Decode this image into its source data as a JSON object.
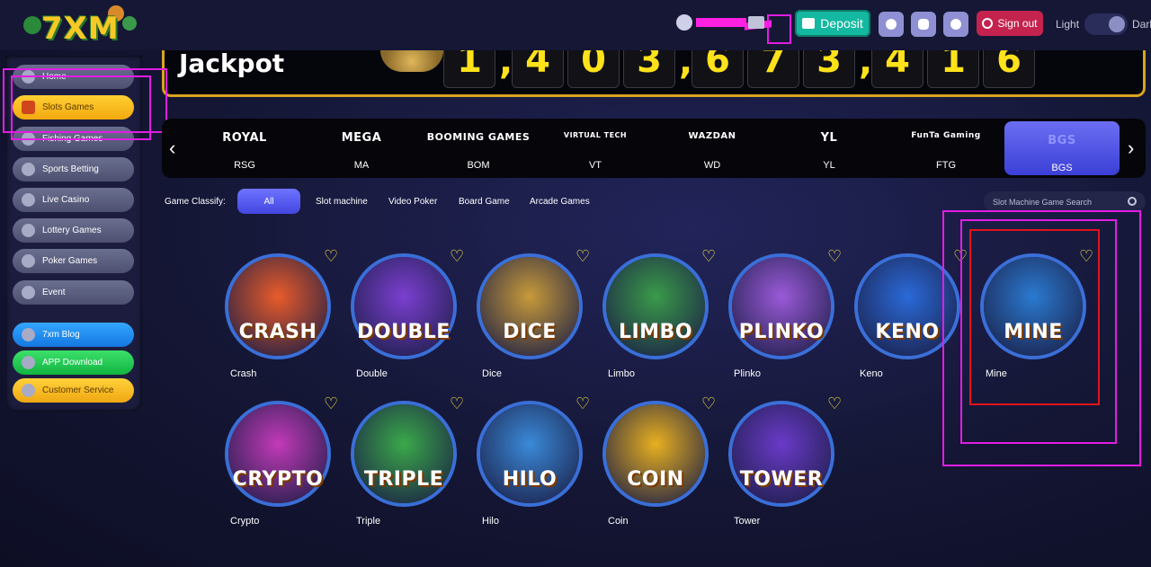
{
  "header": {
    "logo_text": "7XM",
    "deposit_label": "Deposit",
    "signout_label": "Sign out",
    "theme_light_label": "Light",
    "theme_dark_label": "Dark"
  },
  "jackpot": {
    "label": "Jackpot",
    "digits": [
      "1",
      "4",
      "0",
      "3",
      "6",
      "7",
      "3",
      "4",
      "1",
      "6"
    ]
  },
  "sidebar": {
    "items": [
      {
        "label": "Home",
        "icon": "home-icon"
      },
      {
        "label": "Slots Games",
        "icon": "slots-icon"
      },
      {
        "label": "Fishing Games",
        "icon": "fish-icon"
      },
      {
        "label": "Sports Betting",
        "icon": "soccer-ball-icon"
      },
      {
        "label": "Live Casino",
        "icon": "casino-chip-icon"
      },
      {
        "label": "Lottery Games",
        "icon": "lottery-icon"
      },
      {
        "label": "Poker Games",
        "icon": "poker-icon"
      },
      {
        "label": "Event",
        "icon": "event-icon"
      }
    ],
    "links": [
      {
        "label": "7xm Blog",
        "icon": "blog-icon"
      },
      {
        "label": "APP Download",
        "icon": "download-icon"
      },
      {
        "label": "Customer Service",
        "icon": "support-icon"
      }
    ]
  },
  "providers": [
    {
      "name": "RSG",
      "logo": "ROYAL"
    },
    {
      "name": "MA",
      "logo": "MEGA"
    },
    {
      "name": "BOM",
      "logo": "BOOMING GAMES"
    },
    {
      "name": "VT",
      "logo": "VIRTUAL TECH"
    },
    {
      "name": "WD",
      "logo": "WAZDAN"
    },
    {
      "name": "YL",
      "logo": "YL"
    },
    {
      "name": "FTG",
      "logo": "FunTa Gaming"
    },
    {
      "name": "BGS",
      "logo": "BGS"
    }
  ],
  "classify": {
    "label": "Game Classify:",
    "tabs": [
      "All",
      "Slot machine",
      "Video Poker",
      "Board Game",
      "Arcade Games"
    ],
    "search_placeholder": "Slot Machine Game Search"
  },
  "games": [
    {
      "name": "Crash",
      "word": "CRASH",
      "color": "#e85b2a"
    },
    {
      "name": "Double",
      "word": "DOUBLE",
      "color": "#7b3fd0"
    },
    {
      "name": "Dice",
      "word": "DICE",
      "color": "#c79a3a"
    },
    {
      "name": "Limbo",
      "word": "LIMBO",
      "color": "#3a9a4a"
    },
    {
      "name": "Plinko",
      "word": "PLINKO",
      "color": "#9a5ad8"
    },
    {
      "name": "Keno",
      "word": "KENO",
      "color": "#2a6ad8"
    },
    {
      "name": "Mine",
      "word": "MINE",
      "color": "#2a7ad0"
    },
    {
      "name": "Crypto",
      "word": "CRYPTO",
      "color": "#c23ab8"
    },
    {
      "name": "Triple",
      "word": "TRIPLE",
      "color": "#3aa84a"
    },
    {
      "name": "Hilo",
      "word": "HILO",
      "color": "#3a8ad8"
    },
    {
      "name": "Coin",
      "word": "COIN",
      "color": "#e8b020"
    },
    {
      "name": "Tower",
      "word": "TOWER",
      "color": "#6a3ac8"
    }
  ],
  "colors": {
    "accent": "#f7c826",
    "deposit": "#14b8a0",
    "signout": "#c4234e",
    "active_tab": "#4346e0",
    "heart": "#f5e43a",
    "highlight_pink": "#e11de3",
    "highlight_red": "#e0141c"
  }
}
